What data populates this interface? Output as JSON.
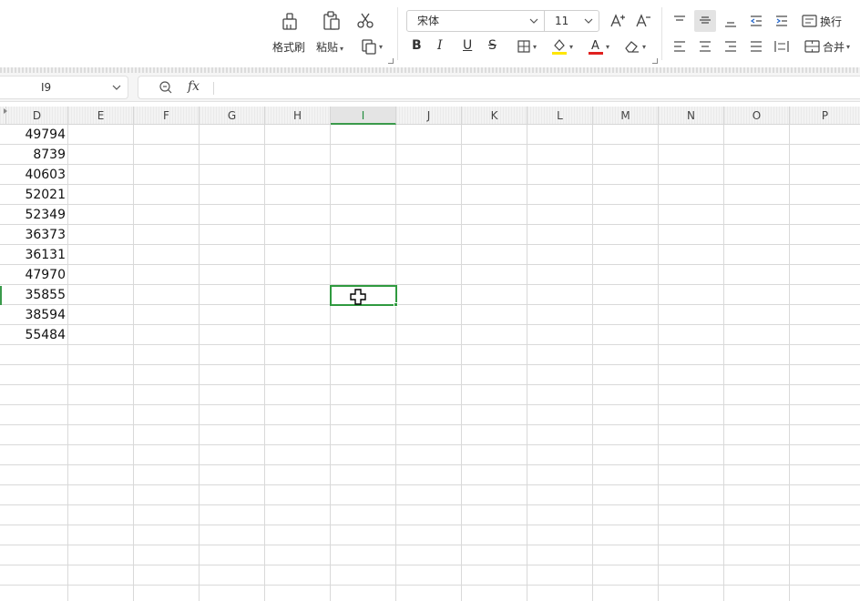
{
  "ribbon": {
    "format_painter_label": "格式刷",
    "paste_label": "粘贴",
    "font_name": "宋体",
    "font_size": "11",
    "bold": "B",
    "italic": "I",
    "underline": "U",
    "strikethrough": "S",
    "font_color_letter": "A",
    "wrap_label": "换行",
    "merge_label": "合并",
    "fill_color": "#ffe600",
    "font_color": "#e0211f"
  },
  "formula_bar": {
    "cell_ref": "I9",
    "fx_label": "fx",
    "formula": ""
  },
  "sheet": {
    "columns": [
      "D",
      "E",
      "F",
      "G",
      "H",
      "I",
      "J",
      "K",
      "L",
      "M",
      "N",
      "O",
      "P"
    ],
    "selected_column": "I",
    "active_cell": "I9",
    "column_d_values": [
      "49794",
      "8739",
      "40603",
      "52021",
      "52349",
      "36373",
      "36131",
      "47970",
      "35855",
      "38594",
      "55484"
    ]
  },
  "colors": {
    "accent_green": "#2f9a3f"
  }
}
